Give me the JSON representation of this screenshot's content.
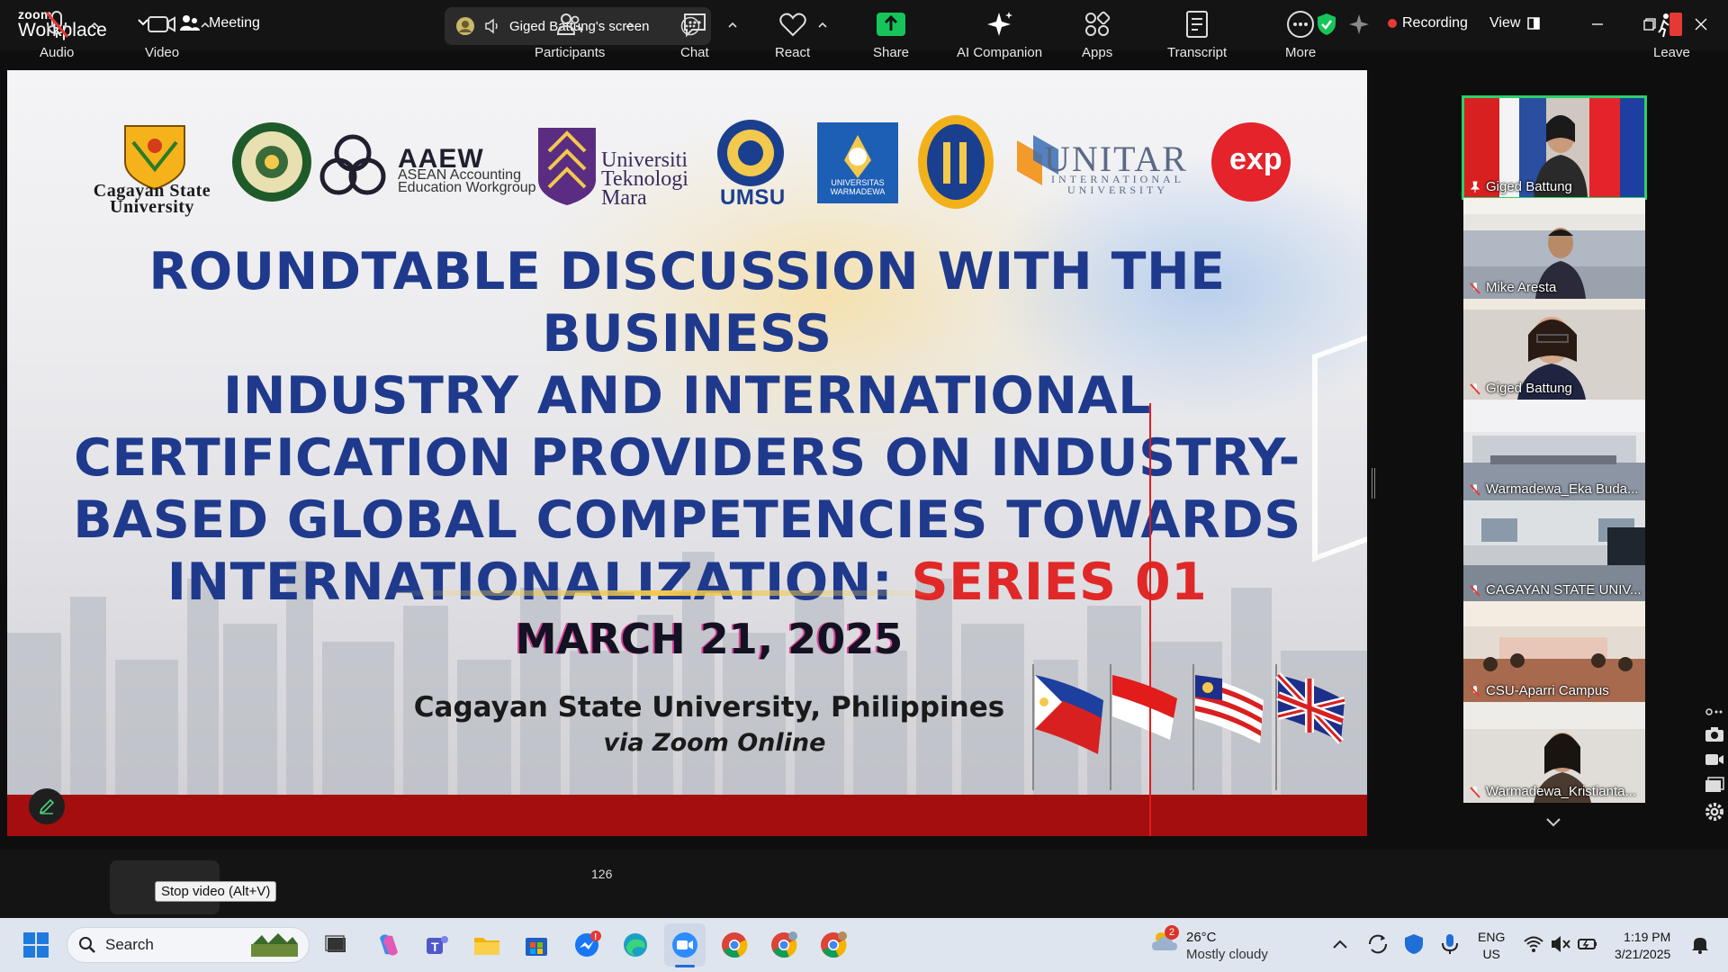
{
  "app": {
    "brand_top": "zoom",
    "brand_bottom": "Workplace",
    "meeting_label": "Meeting",
    "screen_share_label": "Giged Battung's screen",
    "recording_label": "Recording",
    "view_label": "View"
  },
  "slide": {
    "logos": {
      "csu": "Cagayan State University",
      "aaew_title": "AAEW",
      "aaew_sub_1": "ASEAN Accounting",
      "aaew_sub_2": "Education Workgroup",
      "uitm_1": "Universiti",
      "uitm_2": "Teknologi",
      "uitm_3": "Mara",
      "umsu": "UMSU",
      "warmadewa_1": "UNIVERSITAS",
      "warmadewa_2": "WARMADEWA",
      "unitar": "UNITAR",
      "unitar_sub_1": "INTERNATIONAL",
      "unitar_sub_2": "UNIVERSITY",
      "exp": "exp"
    },
    "headline_line1": "ROUNDTABLE DISCUSSION WITH THE BUSINESS",
    "headline_line2": "INDUSTRY AND INTERNATIONAL",
    "headline_line3": "CERTIFICATION PROVIDERS ON INDUSTRY-",
    "headline_line4": "BASED GLOBAL COMPETENCIES TOWARDS",
    "headline_line5_main": "INTERNATIONALIZATION: ",
    "headline_line5_accent": "SERIES 01",
    "date": "MARCH 21, 2025",
    "venue": "Cagayan State University, Philippines",
    "via": "via Zoom Online",
    "flags": [
      "philippines-flag",
      "indonesia-flag",
      "malaysia-flag",
      "uk-flag"
    ]
  },
  "participants": [
    {
      "name": "Giged Battung",
      "muted": false,
      "active": true
    },
    {
      "name": "Mike Aresta",
      "muted": true,
      "active": false
    },
    {
      "name": "Giged Battung",
      "muted": true,
      "active": false
    },
    {
      "name": "Warmadewa_Eka Buda...",
      "muted": true,
      "active": false
    },
    {
      "name": "CAGAYAN STATE UNIV...",
      "muted": true,
      "active": false
    },
    {
      "name": "CSU-Aparri Campus",
      "muted": true,
      "active": false
    },
    {
      "name": "Warmadewa_Kristianta...",
      "muted": true,
      "active": false
    }
  ],
  "toolbar": {
    "audio": "Audio",
    "video": "Video",
    "video_tooltip": "Stop video (Alt+V)",
    "participants": "Participants",
    "participant_count": "126",
    "chat": "Chat",
    "react": "React",
    "share": "Share",
    "ai_companion": "AI Companion",
    "apps": "Apps",
    "transcript": "Transcript",
    "more": "More",
    "leave": "Leave"
  },
  "taskbar": {
    "search_placeholder": "Search",
    "weather_temp": "26°C",
    "weather_desc": "Mostly cloudy",
    "weather_badge": "2",
    "lang_1": "ENG",
    "lang_2": "US",
    "time": "1:19 PM",
    "date": "3/21/2025"
  },
  "colors": {
    "share_green": "#16c55a",
    "record_red": "#e53935",
    "active_border": "#2bd06b",
    "headline_blue": "#1f3a8c",
    "accent_red": "#e02828"
  }
}
